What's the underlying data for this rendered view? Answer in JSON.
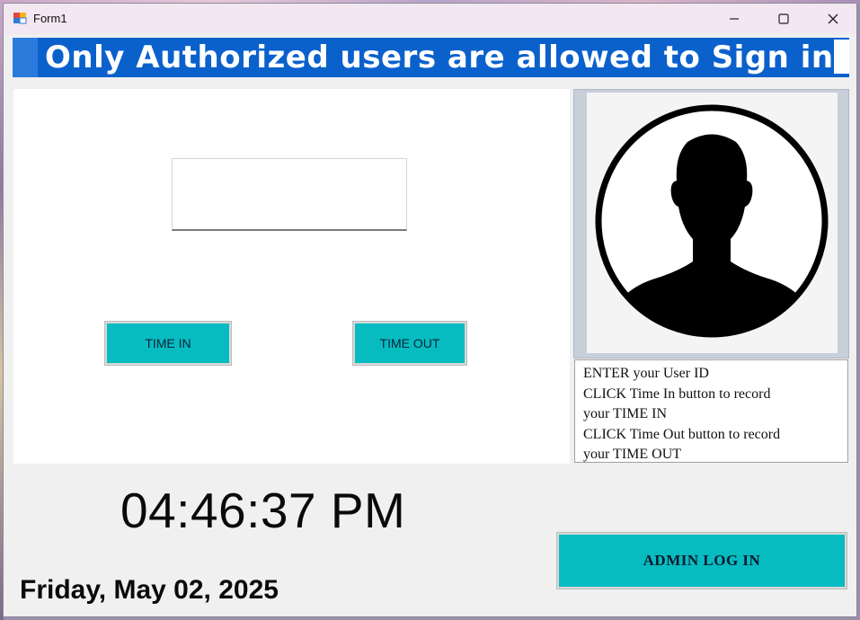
{
  "window": {
    "title": "Form1",
    "controls": {
      "minimize": "minimize-icon",
      "maximize": "maximize-icon",
      "close": "close-icon"
    }
  },
  "banner": {
    "text": "Only Authorized users are allowed to Sign in",
    "color": "#0b61cc"
  },
  "user_id_input": {
    "value": "",
    "placeholder": ""
  },
  "buttons": {
    "time_in": "TIME IN",
    "time_out": "TIME OUT",
    "admin_login": "ADMIN LOG IN",
    "color": "#06bcc1"
  },
  "photo": {
    "icon": "user-silhouette-icon"
  },
  "instructions": {
    "lines": [
      "ENTER your User ID",
      "CLICK Time In button  to record",
      "your TIME IN",
      "CLICK Time Out button to record",
      "your TIME OUT"
    ]
  },
  "clock": {
    "time": "04:46:37 PM",
    "date": "Friday, May 02, 2025"
  }
}
